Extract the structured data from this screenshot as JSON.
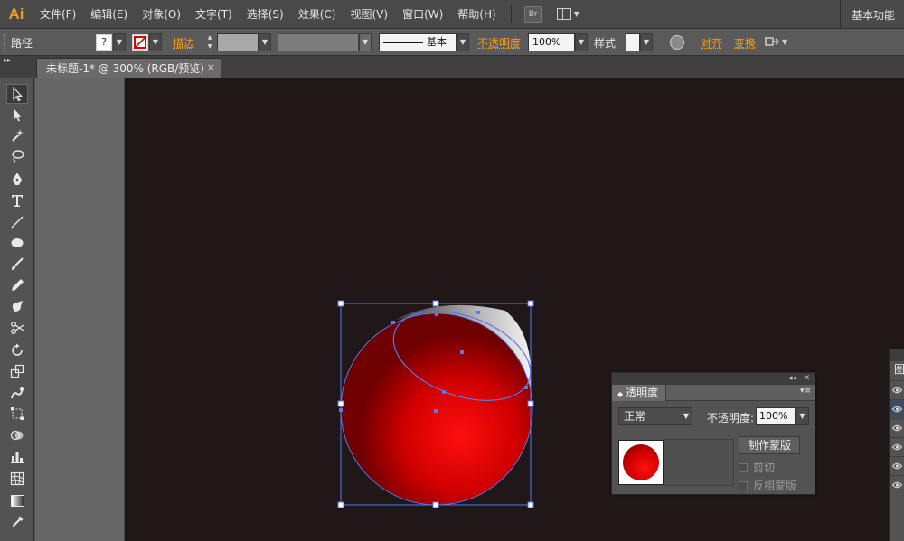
{
  "app": {
    "logo": "Ai",
    "workspace": "基本功能"
  },
  "menu": [
    "文件(F)",
    "编辑(E)",
    "对象(O)",
    "文字(T)",
    "选择(S)",
    "效果(C)",
    "视图(V)",
    "窗口(W)",
    "帮助(H)"
  ],
  "menubar_buttons": {
    "bridge": "Br"
  },
  "control_bar": {
    "selection_label": "路径",
    "fill_glyph": "?",
    "stroke_label": "描边",
    "stroke_profile": "基本",
    "opacity_label": "不透明度",
    "opacity_value": "100%",
    "style_label": "样式",
    "align_label": "对齐",
    "transform_label": "变换"
  },
  "document": {
    "tab_title": "未标题-1* @ 300% (RGB/预览)",
    "close_glyph": "×"
  },
  "tools": [
    "selection-tool",
    "direct-selection-tool",
    "magic-wand-tool",
    "lasso-tool",
    "pen-tool",
    "type-tool",
    "line-segment-tool",
    "ellipse-tool",
    "paintbrush-tool",
    "pencil-tool",
    "blob-brush-tool",
    "scissors-tool",
    "rotate-tool",
    "scale-tool",
    "warp-tool",
    "free-transform-tool",
    "shape-builder-tool",
    "column-graph-tool",
    "mesh-tool",
    "gradient-tool",
    "eyedropper-tool"
  ],
  "artwork": {
    "fill_color_center": "#ff0f0f",
    "fill_color_mid": "#d10000",
    "fill_color_edge": "#6e0000",
    "selection_color": "#5a78e6"
  },
  "transparency_panel": {
    "collapse_glyph": "◂◂",
    "close_glyph": "✕",
    "title": "透明度",
    "menu_glyph": "▾≡",
    "blend_mode": "正常",
    "opacity_label": "不透明度:",
    "opacity_value": "100%",
    "make_mask_button": "制作蒙版",
    "clip_label": "剪切",
    "invert_mask_label": "反相蒙版"
  },
  "layers_panel_peek": {
    "title_fragment": "图"
  }
}
